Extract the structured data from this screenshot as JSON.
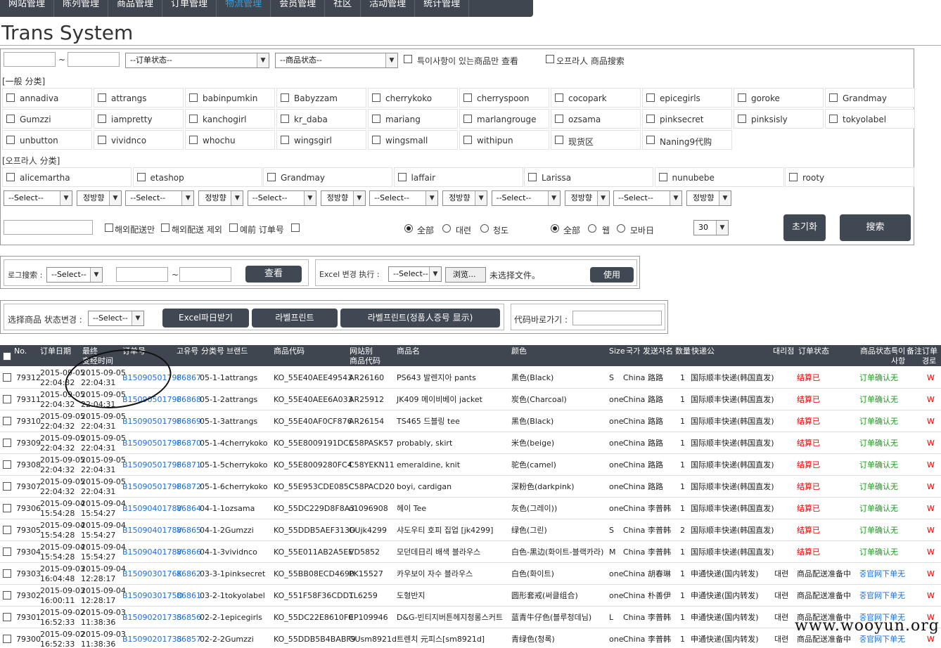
{
  "nav": [
    "网站管理",
    "陈列管理",
    "商品管理",
    "订单管理",
    "物流管理",
    "会员管理",
    "社区",
    "活动管理",
    "统计管理"
  ],
  "nav_active": 4,
  "title": "Trans System",
  "filters": {
    "tilde": "~",
    "order_status": "--订单状态--",
    "goods_status": "--商品状态--",
    "special_only": "특이사항이 있는商品만 查看",
    "offline_search": "오프라人 商品搜索",
    "general_cat": "[一般 分类]",
    "offline_cat": "[오프라人 分类]",
    "select_placeholder": "--Select--",
    "sort_label": "정방향",
    "overseas_only": "해외配送만",
    "overseas_except": "해외配送 제외",
    "reserve_order": "예前 订单号",
    "radio_group1": [
      "全部",
      "대련",
      "청도"
    ],
    "radio_group2": [
      "全部",
      "웹",
      "모바日"
    ],
    "page_size": "30",
    "reset_btn": "초기화",
    "search_btn": "搜索"
  },
  "brands_general": [
    "annadiva",
    "attrangs",
    "babinpumkin",
    "Babyzzam",
    "cherrykoko",
    "cherryspoon",
    "cocopark",
    "epicegirls",
    "goroke",
    "Grandmay",
    "Gumzzi",
    "iampretty",
    "kanchogirl",
    "kr_daba",
    "mariang",
    "marlangrouge",
    "ozsama",
    "pinksecret",
    "pinksisly",
    "tokyolabel",
    "unbutton",
    "vividnco",
    "whochu",
    "wingsgirl",
    "wingsmall",
    "withipun",
    "现货区",
    "Naning9代购"
  ],
  "brands_offline": [
    "alicemartha",
    "etashop",
    "Grandmay",
    "laffair",
    "Larissa",
    "nunubebe",
    "rooty"
  ],
  "log_panel": {
    "label": "로그搜索 :",
    "select": "--Select--",
    "tilde": "~",
    "button": "查看",
    "excel_label": "Excel 변경 执行 :",
    "excel_select": "--Select--",
    "browse": "浏览...",
    "no_file": "未选择文件。",
    "use": "使用"
  },
  "action_panel": {
    "label": "选择商品 状态변경 :",
    "select": "--Select--",
    "btn_excel": "Excel파日받기",
    "btn_label": "라벨프린트",
    "btn_label2": "라벨프린트(정품人증号 显示)",
    "code_jump": "代码바로가기 :"
  },
  "headers": {
    "no": "No.",
    "order_date": "订单日期",
    "last_change": "最终",
    "last_change2": "变经时间",
    "order_no": "订单号",
    "unique_no": "고유号",
    "cat_no": "分类号",
    "brand": "브랜드",
    "goods_code": "商品代码",
    "site_code": "网站别",
    "site_code2": "商品代码",
    "goods_name": "商品名",
    "color": "颜色",
    "size": "Size",
    "country": "국가",
    "sender": "发送자名",
    "qty": "数量",
    "courier": "快递公",
    "agent": "대리점",
    "order_status": "订单状态",
    "goods_status": "商品状态",
    "special": "특이",
    "special2": "사항",
    "note": "备注",
    "route": "订单",
    "route2": "경로"
  },
  "rows": [
    {
      "no": "79312",
      "d1": "2015-09-05",
      "t1": "22:04:32",
      "d2": "2015-09-05",
      "t2": "22:04:31",
      "order": "B1509050179F",
      "uid": "86867",
      "cat": "05-1-1attrangs",
      "code": "KO_55E40AEE49543",
      "site": "AR26160",
      "name": "PS643 발렌지아 pants",
      "color": "黑色(Black)",
      "size": "S",
      "country": "China",
      "sender": "路路",
      "qty": "1",
      "courier": "国际顺丰快递(韩国直发)",
      "agent": "",
      "ostatus": "结算已",
      "gstatus": "订单确认无",
      "route": "W"
    },
    {
      "no": "79311",
      "d1": "2015-09-05",
      "t1": "22:04:32",
      "d2": "2015-09-05",
      "t2": "22:04:31",
      "order": "B1509050179F",
      "uid": "86868",
      "cat": "05-1-2attrangs",
      "code": "KO_55E40AEE6A033",
      "site": "AR25912",
      "name": "JK409 메이비베이 jacket",
      "color": "炭色(Charcoal)",
      "size": "one",
      "country": "China",
      "sender": "路路",
      "qty": "1",
      "courier": "国际顺丰快递(韩国直发)",
      "agent": "",
      "ostatus": "结算已",
      "gstatus": "订单确认无",
      "route": "W"
    },
    {
      "no": "79310",
      "d1": "2015-09-05",
      "t1": "22:04:32",
      "d2": "2015-09-05",
      "t2": "22:04:31",
      "order": "B1509050179F",
      "uid": "86869",
      "cat": "05-1-3attrangs",
      "code": "KO_55E40AF0CF876",
      "site": "AR26154",
      "name": "TS465 드블링 tee",
      "color": "黑色(Black)",
      "size": "one",
      "country": "China",
      "sender": "路路",
      "qty": "1",
      "courier": "国际顺丰快递(韩国直发)",
      "agent": "",
      "ostatus": "结算已",
      "gstatus": "订单确认无",
      "route": "W"
    },
    {
      "no": "79309",
      "d1": "2015-09-05",
      "t1": "22:04:32",
      "d2": "2015-09-05",
      "t2": "22:04:31",
      "order": "B1509050179F",
      "uid": "86870",
      "cat": "05-1-4cherrykoko",
      "code": "KO_55E8009191DC5",
      "site": "C58PASK57",
      "name": "probably, skirt",
      "color": "米色(beige)",
      "size": "one",
      "country": "China",
      "sender": "路路",
      "qty": "1",
      "courier": "国际顺丰快递(韩国直发)",
      "agent": "",
      "ostatus": "结算已",
      "gstatus": "订单确认无",
      "route": "W"
    },
    {
      "no": "79308",
      "d1": "2015-09-05",
      "t1": "22:04:32",
      "d2": "2015-09-05",
      "t2": "22:04:31",
      "order": "B1509050179F",
      "uid": "86871",
      "cat": "05-1-5cherrykoko",
      "code": "KO_55E8009280FC4",
      "site": "C58YEKN11",
      "name": "emeraldine, knit",
      "color": "驼色(camel)",
      "size": "one",
      "country": "China",
      "sender": "路路",
      "qty": "1",
      "courier": "国际顺丰快递(韩国直发)",
      "agent": "",
      "ostatus": "结算已",
      "gstatus": "订单确认无",
      "route": "W"
    },
    {
      "no": "79307",
      "d1": "2015-09-05",
      "t1": "22:04:32",
      "d2": "2015-09-05",
      "t2": "22:04:31",
      "order": "B1509050179F",
      "uid": "86872",
      "cat": "05-1-6cherrykoko",
      "code": "KO_55E953CDE085C",
      "site": "C58PACD20",
      "name": "boyi, cardigan",
      "color": "深粉色(darkpink)",
      "size": "one",
      "country": "China",
      "sender": "路路",
      "qty": "1",
      "courier": "国际顺丰快递(韩国直发)",
      "agent": "",
      "ostatus": "结算已",
      "gstatus": "订单确认无",
      "route": "W"
    },
    {
      "no": "79306",
      "d1": "2015-09-04",
      "t1": "15:54:28",
      "d2": "2015-09-04",
      "t2": "15:54:27",
      "order": "B1509040178V",
      "uid": "86864",
      "cat": "04-1-1ozsama",
      "code": "KO_55DC229D8F8A3",
      "site": "o1096908",
      "name": "헤이 Tee",
      "color": "灰色(그레이))",
      "size": "one",
      "country": "China",
      "sender": "李普韩",
      "qty": "1",
      "courier": "国际顺丰快递(韩国直发)",
      "agent": "",
      "ostatus": "结算已",
      "gstatus": "订单确认无",
      "route": "W"
    },
    {
      "no": "79305",
      "d1": "2015-09-04",
      "t1": "15:54:28",
      "d2": "2015-09-04",
      "t2": "15:54:27",
      "order": "B1509040178V",
      "uid": "86865",
      "cat": "04-1-2Gumzzi",
      "code": "KO_55DDB5AEF313D",
      "site": "GUjk4299",
      "name": "샤도우티 호피 집업 [jk4299]",
      "color": "绿色(그린)",
      "size": "S",
      "country": "China",
      "sender": "李普韩",
      "qty": "2",
      "courier": "国际顺丰快递(韩国直发)",
      "agent": "",
      "ostatus": "结算已",
      "gstatus": "订单确认无",
      "route": "W"
    },
    {
      "no": "79304",
      "d1": "2015-09-04",
      "t1": "15:54:28",
      "d2": "2015-09-04",
      "t2": "15:54:27",
      "order": "B1509040178V",
      "uid": "86866",
      "cat": "04-1-3vividnco",
      "code": "KO_55E011AB2A5EE",
      "site": "VD5852",
      "name": "모던데日리 배색 블라우스",
      "color": "白色-黑边(화이트-블랙카라)",
      "size": "M",
      "country": "China",
      "sender": "李普韩",
      "qty": "1",
      "courier": "国际顺丰快递(韩国直发)",
      "agent": "",
      "ostatus": "结算已",
      "gstatus": "订单确认无",
      "route": "W"
    },
    {
      "no": "79303",
      "d1": "2015-09-03",
      "t1": "16:04:48",
      "d2": "2015-09-04",
      "t2": "12:28:17",
      "order": "B1509030176K",
      "uid": "86862",
      "cat": "03-3-1pinksecret",
      "code": "KO_55BB08ECD4690",
      "site": "PK15527",
      "name": "카우보이 자수 블라우스",
      "color": "白色(화이트)",
      "size": "one",
      "country": "China",
      "sender": "胡春琳",
      "qty": "1",
      "courier": "申通快递(国内转发)",
      "agent": "대련",
      "ostatus": "商品配送准备中",
      "gstatus": "중官网下单无",
      "route": "W"
    },
    {
      "no": "79302",
      "d1": "2015-09-03",
      "t1": "16:00:11",
      "d2": "2015-09-04",
      "t2": "12:28:17",
      "order": "B1509030175O",
      "uid": "86861",
      "cat": "03-2-1tokyolabel",
      "code": "KO_551F58F36CDD1",
      "site": "TL6259",
      "name": "도형반지",
      "color": "圆形套戒(써클组合)",
      "size": "one",
      "country": "China",
      "sender": "朴善伊",
      "qty": "1",
      "courier": "申通快递(国内转发)",
      "agent": "대련",
      "ostatus": "商品配送准备中",
      "gstatus": "중官网下单无",
      "route": "W"
    },
    {
      "no": "79301",
      "d1": "2015-09-02",
      "t1": "16:52:33",
      "d2": "2015-09-03",
      "t2": "11:38:36",
      "order": "B1509020173S",
      "uid": "86856",
      "cat": "02-2-1epicegirls",
      "code": "KO_55DC22E8610F0",
      "site": "EP109946",
      "name": "D&G-빈티지버튼헤지청롱스커트",
      "color": "蓝青牛仔色(블루청데님)",
      "size": "L",
      "country": "China",
      "sender": "李普韩",
      "qty": "1",
      "courier": "申通快递(国内转发)",
      "agent": "대련",
      "ostatus": "商品配送准备中",
      "gstatus": "중官网下单无",
      "route": "W"
    },
    {
      "no": "79300",
      "d1": "2015-09-02",
      "t1": "16:52:33",
      "d2": "2015-09-03",
      "t2": "11:38:36",
      "order": "B1509020173S",
      "uid": "86857",
      "cat": "02-2-2Gumzzi",
      "code": "KO_55DDB5B4BABF9",
      "site": "GUsm8921d",
      "name": "트렌치 元피스[sm8921d]",
      "color": "青绿色(청록)",
      "size": "one",
      "country": "China",
      "sender": "李普韩",
      "qty": "1",
      "courier": "申通快递(国内转发)",
      "agent": "대련",
      "ostatus": "商品配送准备中",
      "gstatus": "중官网下单无",
      "route": "W"
    }
  ],
  "watermark": "www.wooyun.org"
}
